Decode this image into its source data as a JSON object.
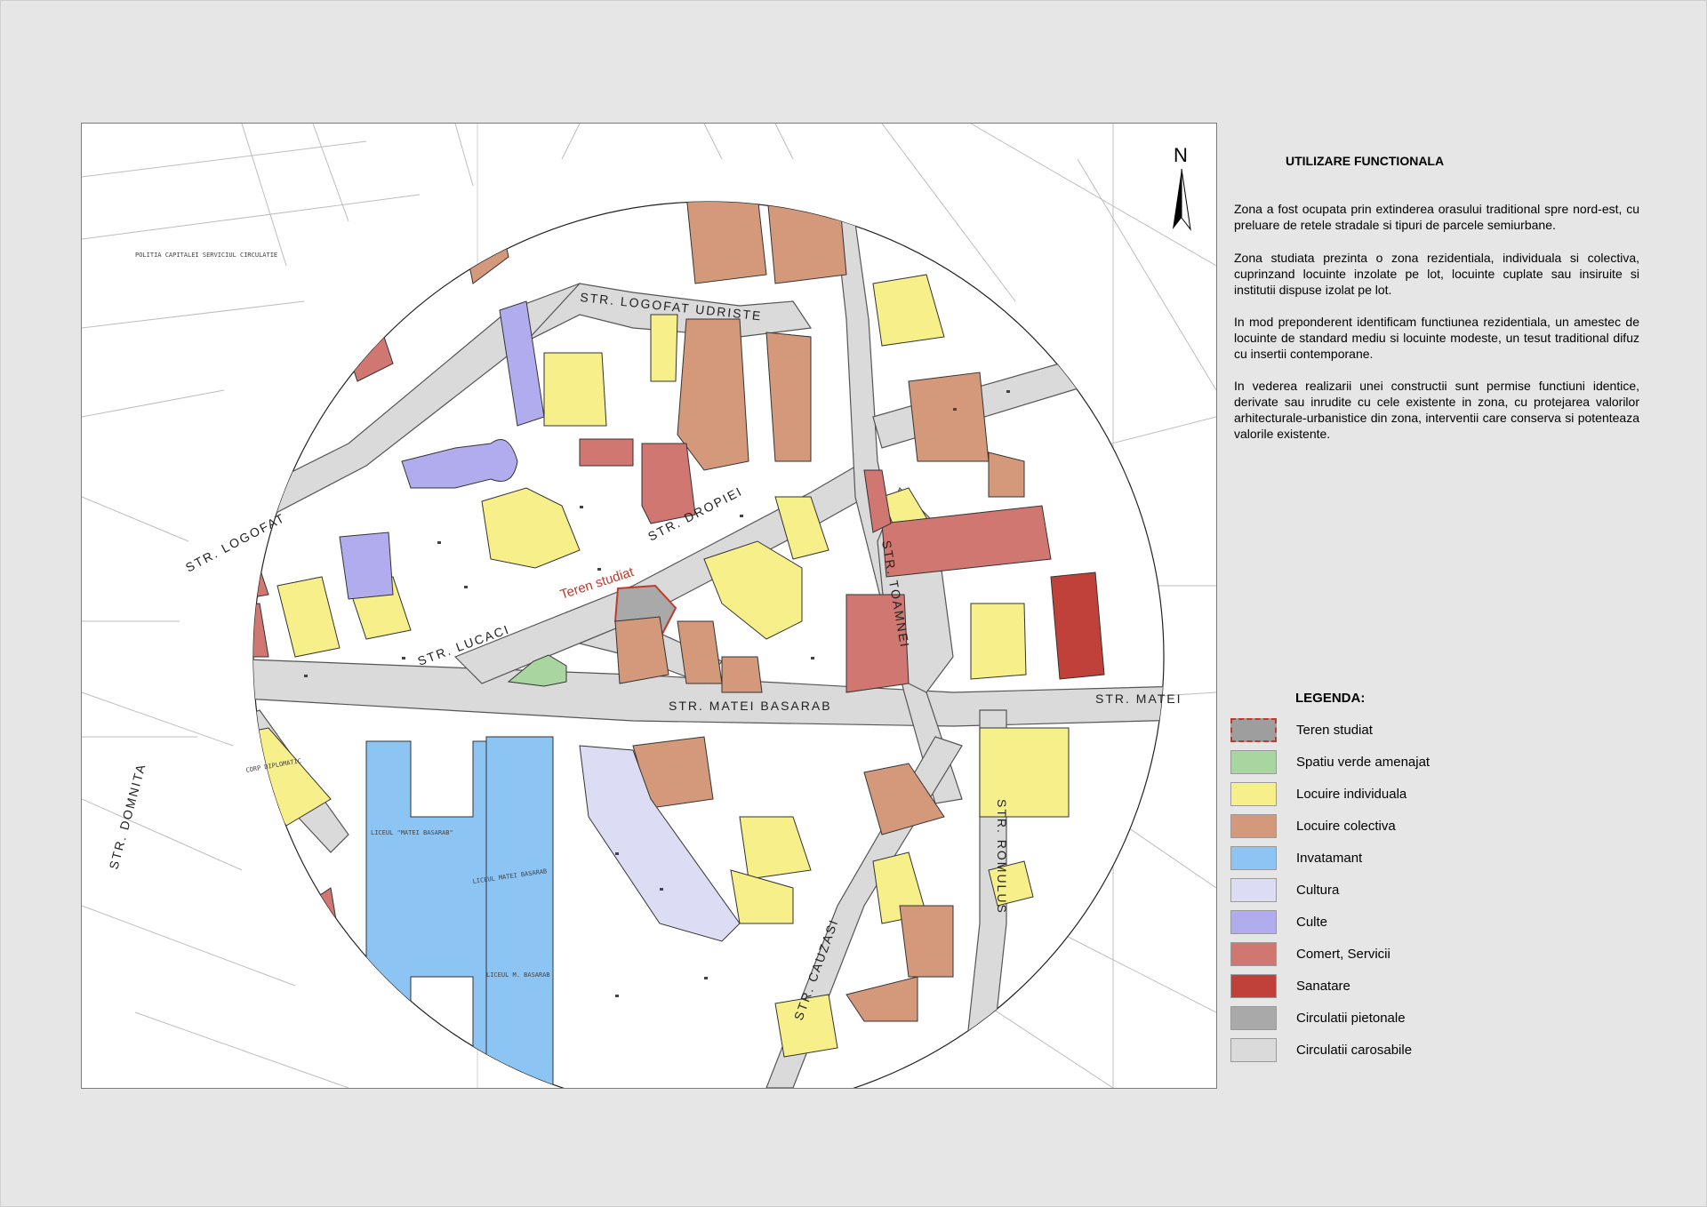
{
  "panel": {
    "title": "UTILIZARE FUNCTIONALA",
    "paragraphs": [
      "Zona a fost ocupata prin extinderea orasului traditional spre nord-est, cu preluare de retele stradale si tipuri de parcele semiurbane.",
      "Zona studiata prezinta o zona rezidentiala, individuala si colectiva, cuprinzand locuinte inzolate pe lot, locuinte cuplate sau insiruite si institutii dispuse izolat pe lot.",
      "In mod preponderent identificam functiunea rezidentiala, un amestec de locuinte de standard mediu si locuinte modeste, un tesut traditional difuz cu insertii contemporane.",
      "In vederea realizarii unei constructii sunt permise functiuni identice, derivate sau inrudite cu cele existente in zona, cu protejarea valorilor arhitecturale-urbanistice din zona, interventii care conserva si potenteaza valorile existente."
    ]
  },
  "legend": {
    "title": "LEGENDA:",
    "items": [
      {
        "label": "Teren studiat",
        "color": "#9e9e9e",
        "dashed": true
      },
      {
        "label": "Spatiu verde amenajat",
        "color": "#a8d5a0"
      },
      {
        "label": "Locuire individuala",
        "color": "#f7ef8a"
      },
      {
        "label": "Locuire colectiva",
        "color": "#d4987a"
      },
      {
        "label": "Invatamant",
        "color": "#8cc4f4"
      },
      {
        "label": "Cultura",
        "color": "#dcdcf5"
      },
      {
        "label": "Culte",
        "color": "#b1acee"
      },
      {
        "label": "Comert, Servicii",
        "color": "#d07772"
      },
      {
        "label": "Sanatare",
        "color": "#c0413a"
      },
      {
        "label": "Circulatii pietonale",
        "color": "#a9a9a9"
      },
      {
        "label": "Circulatii carosabile",
        "color": "#dadada"
      }
    ]
  },
  "map": {
    "north_label": "N",
    "study_site_label": "Teren studiat",
    "street_labels": [
      "STR. LOGOFAT UDRISTE",
      "STR. MATEI BASARAB",
      "STR. LUCACI",
      "STR. DROPIEI",
      "STR. TOAMNEI",
      "STR. CAUZASI",
      "STR. ROMULUS",
      "STR. MATEI",
      "STR. LOGOFAT",
      "STR. DOMNITA"
    ],
    "building_labels": [
      "LICEUL \"MATEI BASARAB\"",
      "LICEUL MATEI BASARAB",
      "LICEUL M. BASARAB",
      "CORP DIPLOMATIC",
      "POLITIA CAPITALEI SERVICIUL CIRCULATIE"
    ]
  }
}
